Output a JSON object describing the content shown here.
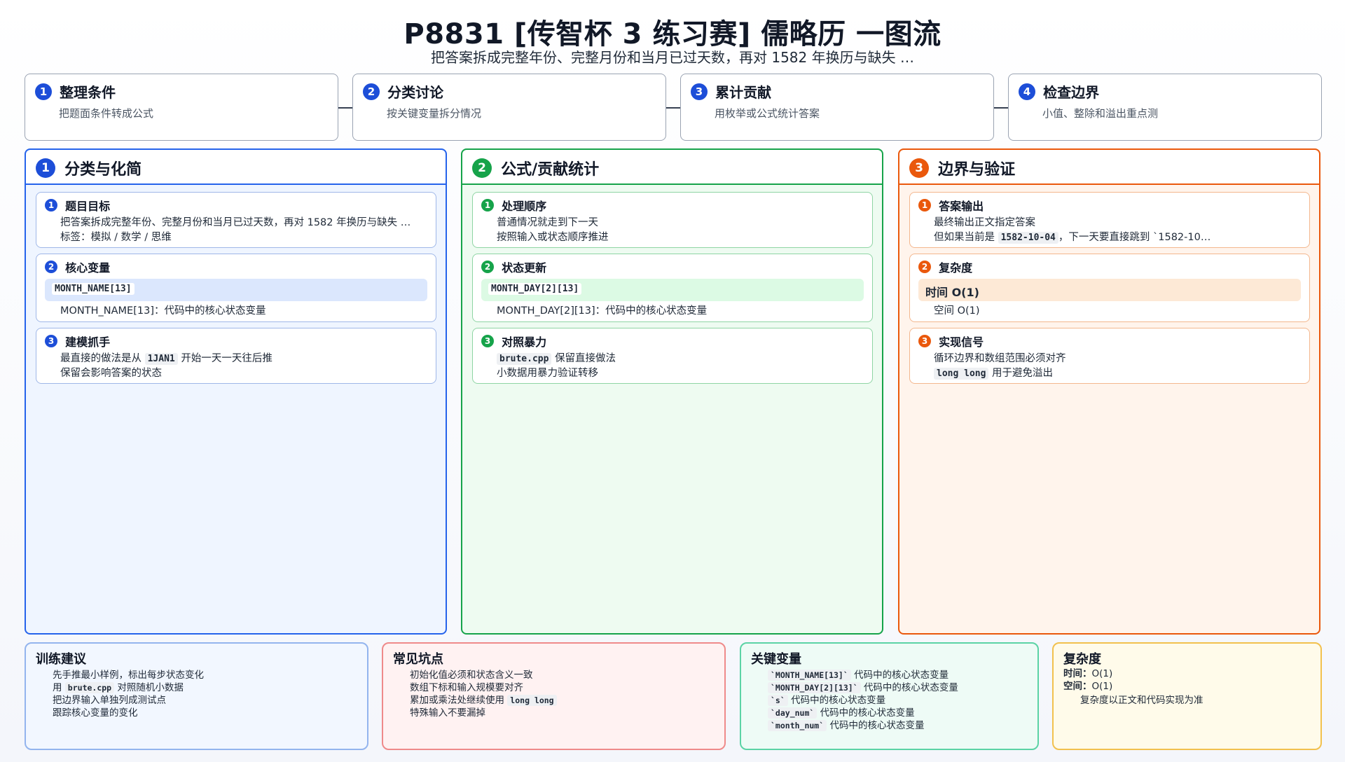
{
  "title": "P8831 [传智杯 3 练习赛] 儒略历 一图流",
  "subtitle": "把答案拆成完整年份、完整月份和当月已过天数，再对 1582 年换历与缺失 …",
  "steps": [
    {
      "num": "1",
      "title": "整理条件",
      "desc": "把题面条件转成公式"
    },
    {
      "num": "2",
      "title": "分类讨论",
      "desc": "按关键变量拆分情况"
    },
    {
      "num": "3",
      "title": "累计贡献",
      "desc": "用枚举或公式统计答案"
    },
    {
      "num": "4",
      "title": "检查边界",
      "desc": "小值、整除和溢出重点测"
    }
  ],
  "columns": [
    {
      "num": "1",
      "title": "分类与化简",
      "cards": [
        {
          "num": "1",
          "title": "题目目标",
          "items": [
            "把答案拆成完整年份、完整月份和当月已过天数，再对 1582 年换历与缺失 …",
            "标签：模拟 / 数学 / 思维"
          ]
        },
        {
          "num": "2",
          "title": "核心变量",
          "pill": "MONTH_NAME[13]",
          "items": [
            "MONTH_NAME[13]：代码中的核心状态变量"
          ]
        },
        {
          "num": "3",
          "title": "建模抓手",
          "items_pre": "最直接的做法是从 ",
          "items_code": "1JAN1",
          "items_post": " 开始一天一天往后推",
          "item2": "保留会影响答案的状态"
        }
      ]
    },
    {
      "num": "2",
      "title": "公式/贡献统计",
      "cards": [
        {
          "num": "1",
          "title": "处理顺序",
          "items": [
            "普通情况就走到下一天",
            "按照输入或状态顺序推进"
          ]
        },
        {
          "num": "2",
          "title": "状态更新",
          "pill": "MONTH_DAY[2][13]",
          "items": [
            "MONTH_DAY[2][13]：代码中的核心状态变量"
          ]
        },
        {
          "num": "3",
          "title": "对照暴力",
          "code1": "brute.cpp",
          "text1": " 保留直接做法",
          "item2": "小数据用暴力验证转移"
        }
      ]
    },
    {
      "num": "3",
      "title": "边界与验证",
      "cards": [
        {
          "num": "1",
          "title": "答案输出",
          "item1": "最终输出正文指定答案",
          "pre2": "但如果当前是 ",
          "code2": "1582-10-04",
          "post2": "，下一天要直接跳到 `1582-10…"
        },
        {
          "num": "2",
          "title": "复杂度",
          "pill": "时间 O(1)",
          "items": [
            "空间 O(1)"
          ]
        },
        {
          "num": "3",
          "title": "实现信号",
          "item1": "循环边界和数组范围必须对齐",
          "code2": "long long",
          "post2": " 用于避免溢出"
        }
      ]
    }
  ],
  "bottom": {
    "training": {
      "title": "训练建议",
      "item1": "先手推最小样例，标出每步状态变化",
      "item2_pre": "用 ",
      "item2_code": "brute.cpp",
      "item2_post": " 对照随机小数据",
      "item3": "把边界输入单独列成测试点",
      "item4": "跟踪核心变量的变化"
    },
    "pitfalls": {
      "title": "常见坑点",
      "item1": "初始化值必须和状态含义一致",
      "item2": "数组下标和输入规模要对齐",
      "item3_pre": "累加或乘法处继续使用 ",
      "item3_code": "long long",
      "item4": "特殊输入不要漏掉"
    },
    "keyvars": {
      "title": "关键变量",
      "items": [
        {
          "code": "`MONTH_NAME[13]`",
          "text": " 代码中的核心状态变量"
        },
        {
          "code": "`MONTH_DAY[2][13]`",
          "text": " 代码中的核心状态变量"
        },
        {
          "code": "`s`",
          "text": " 代码中的核心状态变量"
        },
        {
          "code": "`day_num`",
          "text": " 代码中的核心状态变量"
        },
        {
          "code": "`month_num`",
          "text": " 代码中的核心状态变量"
        }
      ]
    },
    "complexity": {
      "title": "复杂度",
      "time_label": "时间：",
      "time_value": "O(1)",
      "space_label": "空间：",
      "space_value": "O(1)",
      "note": "复杂度以正文和代码实现为准"
    }
  },
  "colors": {
    "blue": "#2563eb",
    "green": "#16a34a",
    "orange": "#ea580c"
  }
}
